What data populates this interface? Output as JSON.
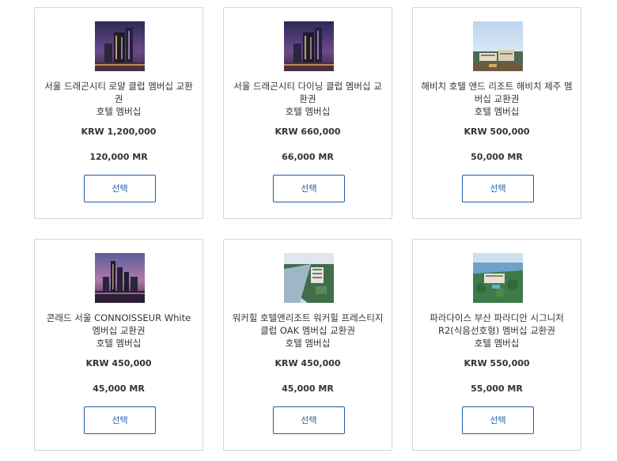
{
  "cards": [
    {
      "title": "서울 드래곤시티 로얄 클럽 멤버십 교환권",
      "category": "호텔 멤버십",
      "price": "KRW 1,200,000",
      "mr": "120,000 MR",
      "button": "선택",
      "image_icon": "hotel-night-skyline-icon"
    },
    {
      "title": "서울 드래곤시티 다이닝 클럽 멤버십 교환권",
      "category": "호텔 멤버십",
      "price": "KRW 660,000",
      "mr": "66,000 MR",
      "button": "선택",
      "image_icon": "hotel-night-skyline-icon"
    },
    {
      "title": "해비치 호텔 앤드 리조트 해비치 제주 멤버십 교환권",
      "category": "호텔 멤버십",
      "price": "KRW 500,000",
      "mr": "50,000 MR",
      "button": "선택",
      "image_icon": "resort-daytime-icon"
    },
    {
      "title": "콘래드 서울 CONNOISSEUR White 멤버십 교환권",
      "category": "호텔 멤버십",
      "price": "KRW 450,000",
      "mr": "45,000 MR",
      "button": "선택",
      "image_icon": "city-dusk-skyline-icon"
    },
    {
      "title": "워커힐 호텔앤리조트 워커힐 프레스티지 클럽 OAK 멤버십 교환권",
      "category": "호텔 멤버십",
      "price": "KRW 450,000",
      "mr": "45,000 MR",
      "button": "선택",
      "image_icon": "riverside-hotel-aerial-icon"
    },
    {
      "title": "파라다이스 부산 파라디안 시그니처 R2(식음선호형) 멤버십 교환권",
      "category": "호텔 멤버십",
      "price": "KRW 550,000",
      "mr": "55,000 MR",
      "button": "선택",
      "image_icon": "seaside-resort-icon"
    }
  ]
}
